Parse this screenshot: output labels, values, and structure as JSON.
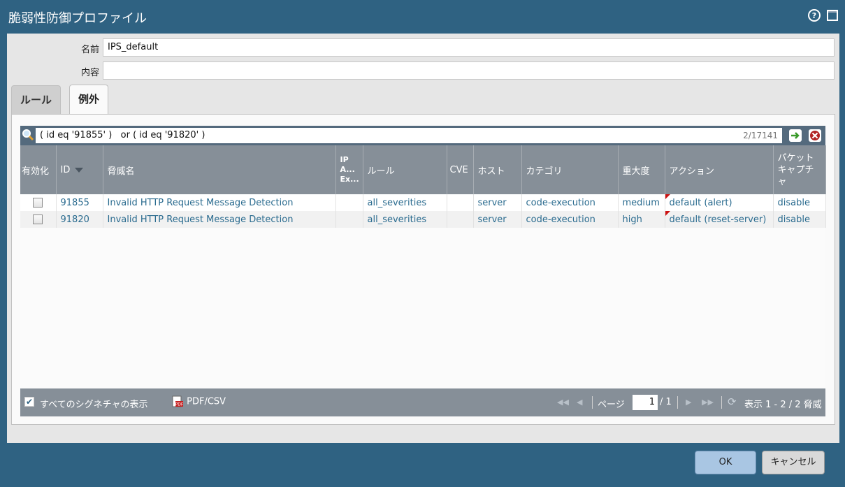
{
  "window": {
    "title": "脆弱性防御プロファイル",
    "help_icon": "help-icon",
    "maximize_icon": "maximize-icon"
  },
  "form": {
    "name_label": "名前",
    "name_value": "IPS_default",
    "desc_label": "内容",
    "desc_value": ""
  },
  "tabs": [
    {
      "label": "ルール",
      "active": false
    },
    {
      "label": "例外",
      "active": true
    }
  ],
  "filter": {
    "query": "( id eq '91855' )   or ( id eq '91820' )",
    "count": "2/17141",
    "apply_icon": "apply-filter-icon",
    "clear_icon": "clear-filter-icon"
  },
  "table": {
    "columns": {
      "enable": "有効化",
      "id": "ID",
      "threat": "脅威名",
      "ip": "IP\nA...\nEx...",
      "rule": "ルール",
      "cve": "CVE",
      "host": "ホスト",
      "category": "カテゴリ",
      "severity": "重大度",
      "action": "アクション",
      "packet": "パケット\nキャプチャ"
    },
    "rows": [
      {
        "enabled": false,
        "id": "91855",
        "threat": "Invalid HTTP Request Message Detection",
        "ip": "",
        "rule": "all_severities",
        "cve": "",
        "host": "server",
        "category": "code-execution",
        "severity": "medium",
        "action": "default (alert)",
        "packet": "disable"
      },
      {
        "enabled": false,
        "id": "91820",
        "threat": "Invalid HTTP Request Message Detection",
        "ip": "",
        "rule": "all_severities",
        "cve": "",
        "host": "server",
        "category": "code-execution",
        "severity": "high",
        "action": "default (reset-server)",
        "packet": "disable"
      }
    ]
  },
  "footer": {
    "show_all_label": "すべてのシグネチャの表示",
    "show_all_checked": true,
    "pdf_label": "PDF/CSV",
    "page_label": "ページ",
    "page_value": "1",
    "page_total": "/ 1",
    "display_label": "表示 1 - 2 / 2 脅威"
  },
  "buttons": {
    "ok": "OK",
    "cancel": "キャンセル"
  }
}
